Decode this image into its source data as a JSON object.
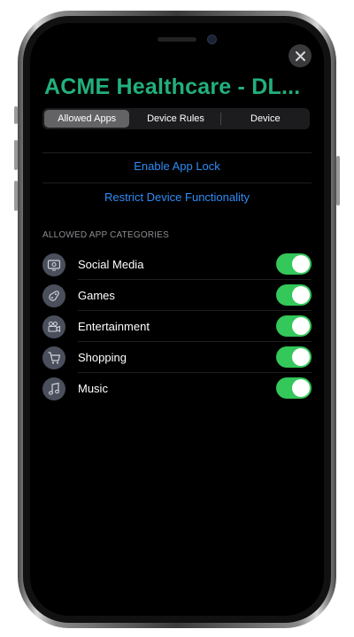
{
  "app": {
    "title": "ACME Healthcare - DL..."
  },
  "close_button": {
    "icon": "close-icon",
    "glyph": "✕"
  },
  "tabs": [
    {
      "label": "Allowed Apps",
      "active": true
    },
    {
      "label": "Device Rules",
      "active": false
    },
    {
      "label": "Device",
      "active": false
    }
  ],
  "actions": {
    "enable_app_lock": "Enable App Lock",
    "restrict_device": "Restrict Device Functionality"
  },
  "categories_section": {
    "header": "ALLOWED APP CATEGORIES",
    "items": [
      {
        "label": "Social Media",
        "icon": "social-media-icon",
        "enabled": true
      },
      {
        "label": "Games",
        "icon": "games-icon",
        "enabled": true
      },
      {
        "label": "Entertainment",
        "icon": "entertainment-icon",
        "enabled": true
      },
      {
        "label": "Shopping",
        "icon": "shopping-icon",
        "enabled": true
      },
      {
        "label": "Music",
        "icon": "music-icon",
        "enabled": true
      }
    ]
  },
  "colors": {
    "title_accent": "#22b07d",
    "link": "#2f8cf5",
    "toggle_on": "#34c759",
    "background": "#000000"
  }
}
